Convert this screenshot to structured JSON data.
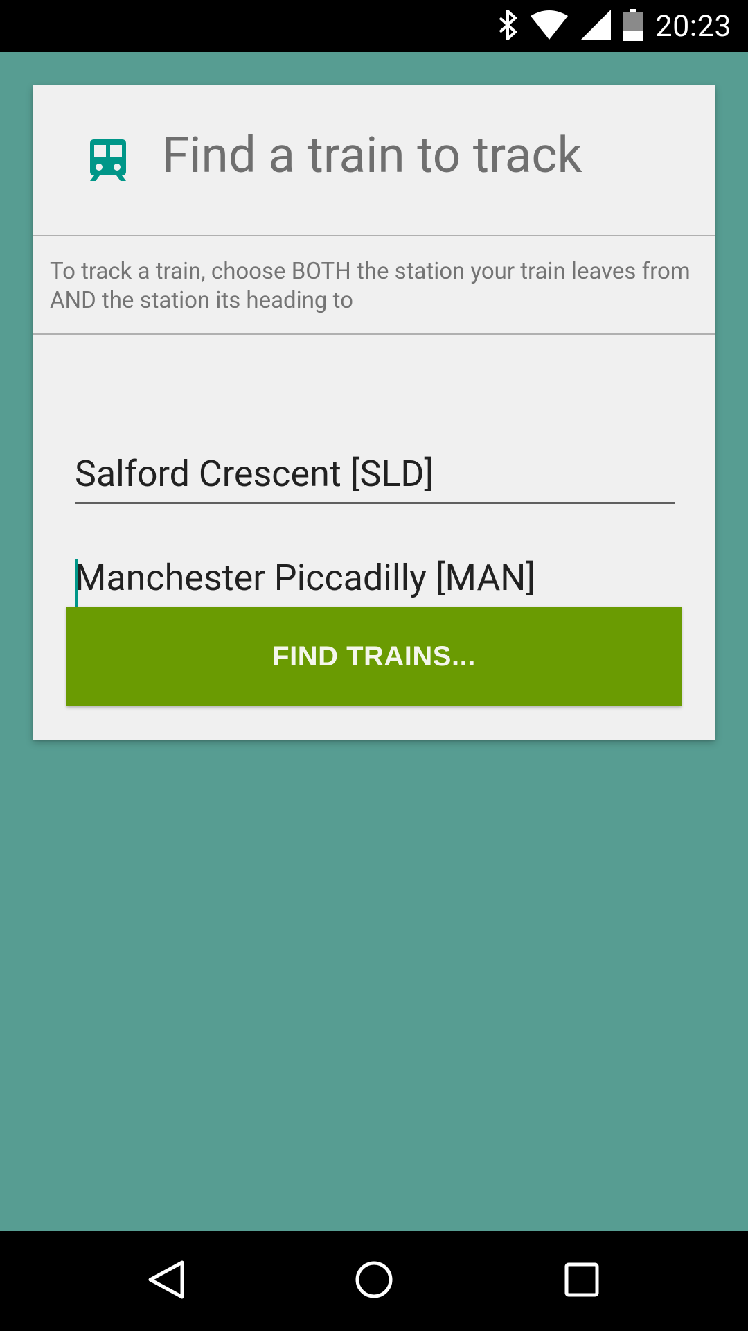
{
  "status_bar": {
    "time": "20:23",
    "icons": [
      "bluetooth-icon",
      "wifi-icon",
      "signal-icon",
      "battery-icon"
    ]
  },
  "card": {
    "icon": "train-icon",
    "title": "Find a train to track",
    "instructions": "To track a train, choose BOTH the station your train leaves from AND the station its heading to"
  },
  "form": {
    "from_station": "Salford Crescent [SLD]",
    "to_station": "Manchester Piccadilly [MAN]",
    "find_button_label": "FIND TRAINS..."
  },
  "nav_bar": {
    "icons": [
      "back-icon",
      "home-icon",
      "recents-icon"
    ]
  },
  "colors": {
    "background": "#579d92",
    "card": "#f0f0f0",
    "accent": "#009688",
    "button": "#6a9b02"
  }
}
